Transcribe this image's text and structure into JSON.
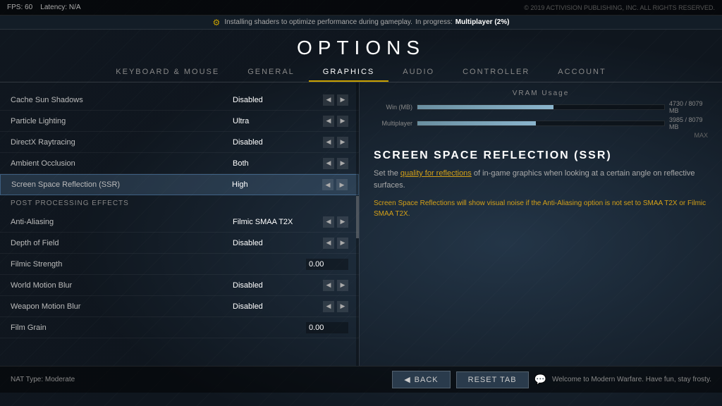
{
  "topBar": {
    "fps": "FPS: 60",
    "latency": "Latency: N/A"
  },
  "notification": {
    "icon": "⚙",
    "text": "Installing shaders to optimize performance during gameplay.",
    "progressLabel": "In progress:",
    "progressValue": "Multiplayer (2%)"
  },
  "title": "OPTIONS",
  "tabs": [
    {
      "id": "keyboard-mouse",
      "label": "Keyboard & Mouse",
      "active": false
    },
    {
      "id": "general",
      "label": "General",
      "active": false
    },
    {
      "id": "graphics",
      "label": "Graphics",
      "active": true
    },
    {
      "id": "audio",
      "label": "Audio",
      "active": false
    },
    {
      "id": "controller",
      "label": "Controller",
      "active": false
    },
    {
      "id": "account",
      "label": "Account",
      "active": false
    }
  ],
  "vram": {
    "title": "VRAM Usage",
    "rows": [
      {
        "label": "Win (MB)",
        "fill": 55,
        "text": "4730 / 8079 MB"
      },
      {
        "label": "Multiplayer",
        "fill": 48,
        "text": "3985 / 8079 MB"
      }
    ],
    "maxLabel": "MAX"
  },
  "ssrPanel": {
    "title": "SCREEN SPACE REFLECTION (SSR)",
    "description": {
      "prefix": "Set the ",
      "highlight": "quality for reflections",
      "suffix": " of in-game graphics when looking at a certain angle on reflective surfaces."
    },
    "warning": "Screen Space Reflections will show visual noise if the Anti-Aliasing option is not set to SMAA T2X or Filmic SMAA T2X."
  },
  "settings": {
    "items": [
      {
        "label": "Cache Sun Shadows",
        "value": "Disabled",
        "hasArrows": true,
        "type": "select"
      },
      {
        "label": "Particle Lighting",
        "value": "Ultra",
        "hasArrows": true,
        "type": "select"
      },
      {
        "label": "DirectX Raytracing",
        "value": "Disabled",
        "hasArrows": true,
        "type": "select"
      },
      {
        "label": "Ambient Occlusion",
        "value": "Both",
        "hasArrows": true,
        "type": "select"
      },
      {
        "label": "Screen Space Reflection (SSR)",
        "value": "High",
        "hasArrows": true,
        "type": "select",
        "highlighted": true
      }
    ],
    "postProcessingHeader": "Post Processing Effects",
    "postProcessingItems": [
      {
        "label": "Anti-Aliasing",
        "value": "Filmic SMAA T2X",
        "hasArrows": true,
        "type": "select"
      },
      {
        "label": "Depth of Field",
        "value": "Disabled",
        "hasArrows": true,
        "type": "select"
      },
      {
        "label": "Filmic Strength",
        "value": "0.00",
        "hasArrows": false,
        "type": "input"
      },
      {
        "label": "World Motion Blur",
        "value": "Disabled",
        "hasArrows": true,
        "type": "select"
      },
      {
        "label": "Weapon Motion Blur",
        "value": "Disabled",
        "hasArrows": true,
        "type": "select"
      },
      {
        "label": "Film Grain",
        "value": "0.00",
        "hasArrows": false,
        "type": "input"
      }
    ]
  },
  "bottomBar": {
    "natInfo": "NAT Type: Moderate",
    "backButton": "Back",
    "resetButton": "Reset Tab",
    "chatMessage": "Welcome to Modern Warfare. Have fun, stay frosty."
  },
  "version": "© 2019 ACTIVISION PUBLISHING, INC. ALL RIGHTS RESERVED."
}
